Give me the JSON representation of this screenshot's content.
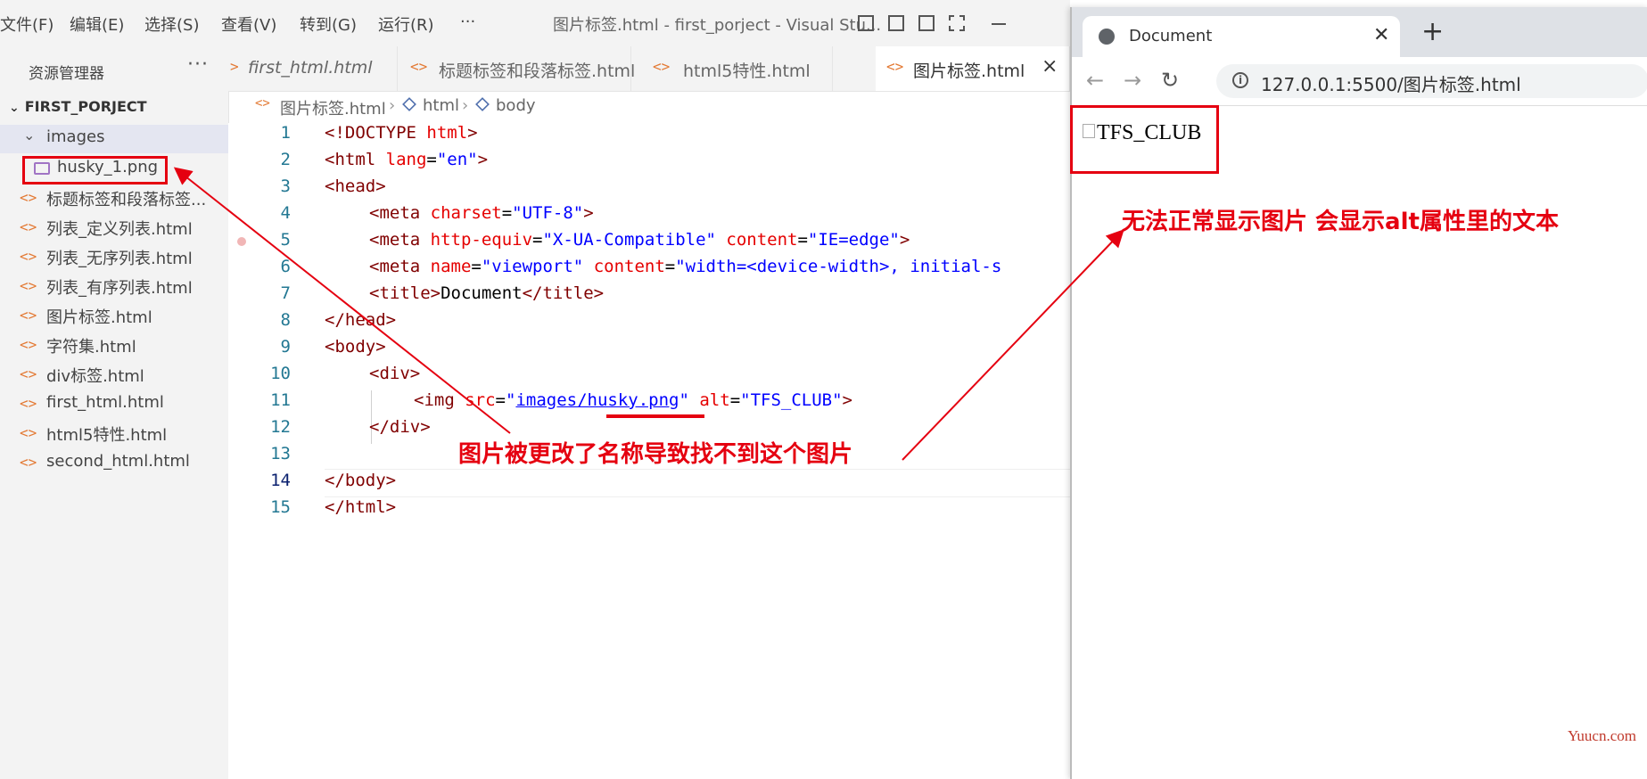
{
  "vscode": {
    "menu": [
      "文件(F)",
      "编辑(E)",
      "选择(S)",
      "查看(V)",
      "转到(G)",
      "运行(R)",
      "···"
    ],
    "window_title": "图片标签.html - first_porject - Visual Stu...",
    "sidebar": {
      "title": "资源管理器",
      "more": "···",
      "project": "FIRST_PORJECT",
      "folder": "images",
      "files": [
        "husky_1.png",
        "标题标签和段落标签...",
        "列表_定义列表.html",
        "列表_无序列表.html",
        "列表_有序列表.html",
        "图片标签.html",
        "字符集.html",
        "div标签.html",
        "first_html.html",
        "html5特性.html",
        "second_html.html"
      ]
    },
    "tabs": [
      "first_html.html",
      "标题标签和段落标签.html",
      "html5特性.html",
      "图片标签.html"
    ],
    "active_tab_close": "×",
    "breadcrumb": [
      "图片标签.html",
      "html",
      "body"
    ],
    "line_numbers": [
      "1",
      "2",
      "3",
      "4",
      "5",
      "6",
      "7",
      "8",
      "9",
      "10",
      "11",
      "12",
      "13",
      "14",
      "15"
    ],
    "code": {
      "l1_tag": "<!DOCTYPE ",
      "l1_kw": "html",
      "l1_end": ">",
      "l2_open": "<html ",
      "l2_attr": "lang",
      "l2_eq": "=",
      "l2_val": "\"en\"",
      "l2_end": ">",
      "l3": "<head>",
      "l4_open": "<meta ",
      "l4_attr": "charset",
      "l4_eq": "=",
      "l4_val": "\"UTF-8\"",
      "l4_end": ">",
      "l5_open": "<meta ",
      "l5_attr": "http-equiv",
      "l5_eq": "=",
      "l5_val": "\"X-UA-Compatible\"",
      "l5_attr2": " content",
      "l5_eq2": "=",
      "l5_val2": "\"IE=edge\"",
      "l5_end": ">",
      "l6_open": "<meta ",
      "l6_attr": "name",
      "l6_eq": "=",
      "l6_val": "\"viewport\"",
      "l6_attr2": " content",
      "l6_eq2": "=",
      "l6_val2": "\"width=<device-width>, initial-s",
      "l7_open": "<title>",
      "l7_text": "Document",
      "l7_close": "</title>",
      "l8": "</head>",
      "l9": "<body>",
      "l10": "<div>",
      "l11_open": "<img ",
      "l11_attr": "src",
      "l11_eq": "=",
      "l11_q1": "\"",
      "l11_val": "images/husky.png",
      "l11_q2": "\"",
      "l11_attr2": " alt",
      "l11_eq2": "=",
      "l11_val2": "\"TFS_CLUB\"",
      "l11_end": ">",
      "l12": "</div>",
      "l14": "</body>",
      "l15": "</html>"
    }
  },
  "browser": {
    "tab_title": "Document",
    "tab_close": "✕",
    "new_tab": "+",
    "back": "←",
    "forward": "→",
    "reload": "↻",
    "info": "i",
    "url": "127.0.0.1:5500/图片标签.html",
    "alt_text": "TFS_CLUB"
  },
  "annotations": {
    "note_browser": "无法正常显示图片 会显示alt属性里的文本",
    "note_editor": "图片被更改了名称导致找不到这个图片"
  },
  "watermark": "Yuucn.com",
  "colors": {
    "annotation_red": "#e50010",
    "tag": "#800000",
    "attr": "#e50000",
    "string": "#0000ff",
    "line_number": "#237893"
  }
}
